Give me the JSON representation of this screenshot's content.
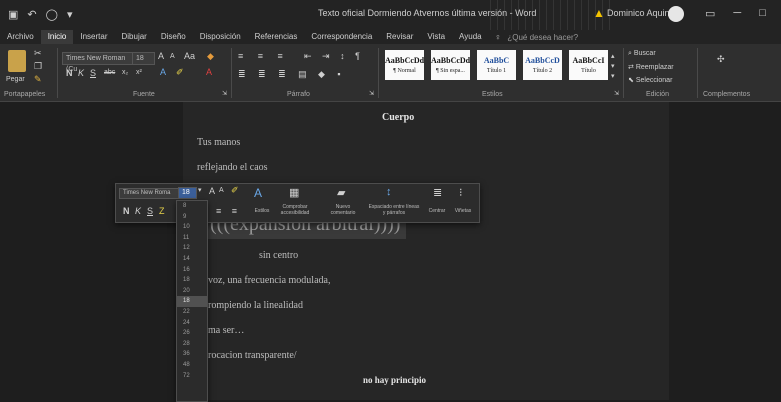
{
  "window": {
    "title": "Texto oficial Dormiendo Atvernos última versión  -  Word",
    "user_name": "Dominico Aquino",
    "quick_access": [
      "save-icon",
      "undo-icon",
      "redo-icon",
      "customize-icon"
    ],
    "controls": [
      "▭",
      "─",
      "□",
      "✕"
    ]
  },
  "tabs": {
    "items": [
      "Archivo",
      "Inicio",
      "Insertar",
      "Dibujar",
      "Diseño",
      "Disposición",
      "Referencias",
      "Correspondencia",
      "Revisar",
      "Vista",
      "Ayuda"
    ],
    "active_index": 1,
    "tell_me": "¿Qué desea hacer?"
  },
  "ribbon": {
    "clipboard": {
      "paste": "Pegar",
      "label": "Portapapeles"
    },
    "font": {
      "name": "Times New Roman (Cu",
      "size": "18",
      "grow": "A",
      "shrink": "A",
      "case": "Aa",
      "format_row": [
        "N",
        "K",
        "S",
        "abc",
        "x₂",
        "x²"
      ],
      "label": "Fuente"
    },
    "paragraph": {
      "label": "Párrafo"
    },
    "styles": {
      "items": [
        {
          "sample": "AaBbCcDd",
          "name": "¶ Normal"
        },
        {
          "sample": "AaBbCcDd",
          "name": "¶ Sin espa..."
        },
        {
          "sample": "AaBbC",
          "name": "Título 1"
        },
        {
          "sample": "AaBbCcD",
          "name": "Título 2"
        },
        {
          "sample": "AaBbCcI",
          "name": "Título"
        }
      ],
      "label": "Estilos"
    },
    "editing": {
      "find": "Buscar",
      "replace": "Reemplazar",
      "select": "Seleccionar",
      "label": "Edición"
    },
    "addins": {
      "label": "Complementos"
    }
  },
  "document": {
    "heading": "Cuerpo",
    "lines": [
      "Tus manos",
      "reflejando el caos",
      "(((expansión arbitral))))",
      "sin centro",
      "voz, una frecuencia modulada,",
      "rompiendo la linealidad",
      "ma ser…",
      "rocacion transparente/",
      "no hay principio"
    ]
  },
  "mini_toolbar": {
    "font_name": "Times New Roma",
    "size": "18",
    "grow": "A",
    "shrink": "A",
    "format_row": [
      "N",
      "K",
      "S",
      "Z"
    ],
    "buttons": [
      {
        "icon": "styles-icon",
        "label": "Estilos"
      },
      {
        "icon": "comment-icon",
        "label": "Nuevo comentario"
      },
      {
        "icon": "spacing-icon",
        "label": "Espaciado entre líneas y párrafos"
      },
      {
        "icon": "center-icon",
        "label": "Centrar"
      },
      {
        "icon": "bullets-icon",
        "label": "Viñetas"
      }
    ],
    "extra": [
      "Comprobar",
      "accesibilidad"
    ]
  },
  "size_list": {
    "items": [
      "8",
      "9",
      "10",
      "11",
      "12",
      "14",
      "16",
      "18",
      "20",
      "22",
      "24",
      "26",
      "28",
      "36",
      "48",
      "72"
    ],
    "selected": "18"
  },
  "colors": {
    "titlebar": "#232323",
    "ribbon": "#2f2f2f",
    "workspace": "#1e1e1e",
    "page": "#262626",
    "warning": "#f2c200"
  }
}
